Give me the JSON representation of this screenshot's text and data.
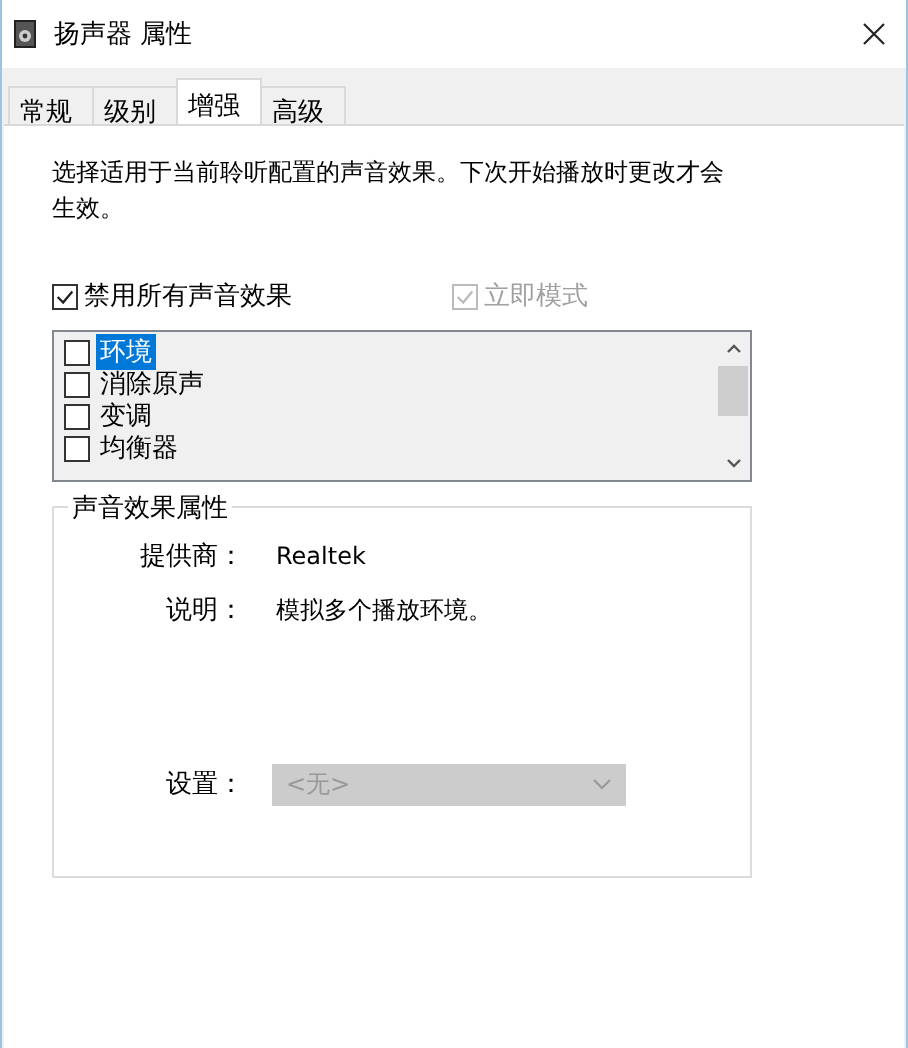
{
  "window": {
    "title": "扬声器 属性"
  },
  "tabs": [
    {
      "label": "常规",
      "selected": false
    },
    {
      "label": "级别",
      "selected": false
    },
    {
      "label": "增强",
      "selected": true
    },
    {
      "label": "高级",
      "selected": false
    }
  ],
  "intro": "选择适用于当前聆听配置的声音效果。下次开始播放时更改才会生效。",
  "disable_all": {
    "label": "禁用所有声音效果",
    "checked": true
  },
  "immediate_mode": {
    "label": "立即模式",
    "checked": true,
    "disabled": true
  },
  "effects": {
    "disabled": true,
    "items": [
      {
        "label": "环境",
        "checked": false,
        "selected": true
      },
      {
        "label": "消除原声",
        "checked": false,
        "selected": false
      },
      {
        "label": "变调",
        "checked": false,
        "selected": false
      },
      {
        "label": "均衡器",
        "checked": false,
        "selected": false
      }
    ]
  },
  "properties": {
    "title": "声音效果属性",
    "fields": [
      {
        "label": "提供商：",
        "value": "Realtek"
      },
      {
        "label": "说明：",
        "value": "模拟多个播放环境。"
      }
    ],
    "setting": {
      "label": "设置：",
      "value": "<无>",
      "disabled": true
    }
  }
}
